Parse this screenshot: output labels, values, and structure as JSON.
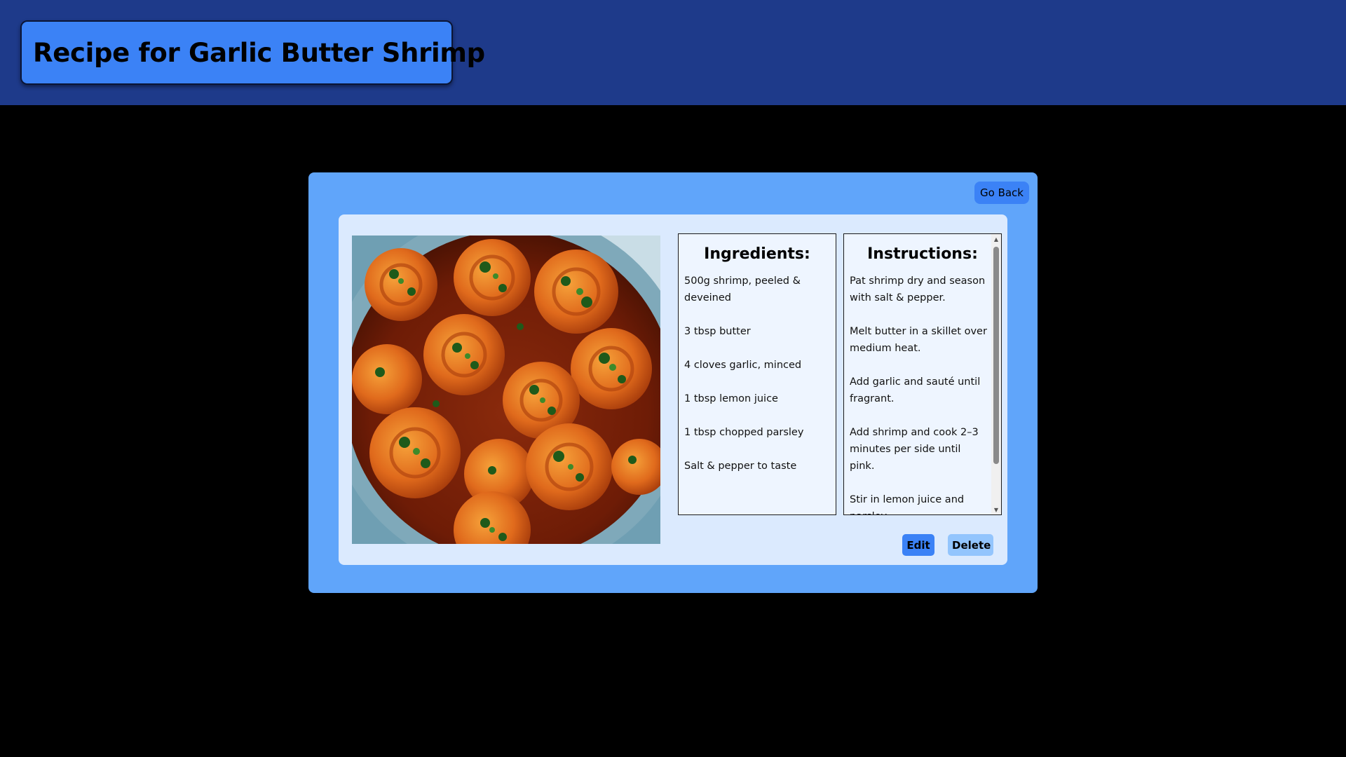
{
  "header": {
    "title": "Recipe for Garlic Butter Shrimp"
  },
  "modal": {
    "go_back_label": "Go Back"
  },
  "recipe": {
    "image_alt": "Garlic butter shrimp in a skillet",
    "ingredients_heading": "Ingredients:",
    "ingredients": [
      "500g shrimp, peeled & deveined",
      "3 tbsp butter",
      "4 cloves garlic, minced",
      "1 tbsp lemon juice",
      "1 tbsp chopped parsley",
      "Salt & pepper to taste"
    ],
    "instructions_heading": "Instructions:",
    "instructions": [
      "Pat shrimp dry and season with salt & pepper.",
      "Melt butter in a skillet over medium heat.",
      "Add garlic and sauté until fragrant.",
      "Add shrimp and cook 2–3 minutes per side until pink.",
      "Stir in lemon juice and parsley."
    ]
  },
  "actions": {
    "edit_label": "Edit",
    "delete_label": "Delete"
  },
  "colors": {
    "topbar": "#1e3a8a",
    "title_box": "#3b82f6",
    "modal": "#60a5fa",
    "card": "#dbeafe",
    "edit_button": "#3b82f6",
    "delete_button": "#93c5fd"
  }
}
